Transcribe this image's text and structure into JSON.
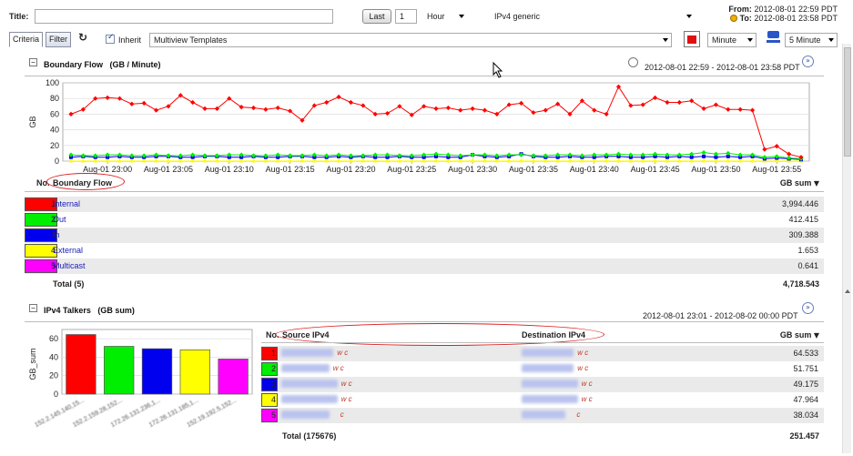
{
  "toolbar": {
    "title_label": "Title:",
    "title_value": "",
    "last_button": "Last",
    "last_count": "1",
    "unit": "Hour",
    "template": "IPv4 generic",
    "from_label": "From:",
    "from_value": "2012-08-01 22:59 PDT",
    "to_label": "To:",
    "to_value": "2012-08-01 23:58 PDT"
  },
  "tabs": [
    {
      "label": "Criteria"
    },
    {
      "label": "Filter"
    }
  ],
  "inherit_label": "Inherit",
  "multiview": "Multiview Templates",
  "granularity": "Minute",
  "interval": "5 Minute",
  "boundary": {
    "title": "Boundary Flow",
    "unit": "(GB / Minute)",
    "range": "2012-08-01 22:59  - 2012-08-01 23:58 PDT",
    "col_no": "No.",
    "col_name": "Boundary Flow",
    "col_sum": "GB sum",
    "rows": [
      {
        "no": "1",
        "name": "Internal",
        "value": "3,994.446",
        "color": "#ff0000"
      },
      {
        "no": "2",
        "name": "Out",
        "value": "412.415",
        "color": "#00ee00"
      },
      {
        "no": "3",
        "name": "In",
        "value": "309.388",
        "color": "#0000ee"
      },
      {
        "no": "4",
        "name": "External",
        "value": "1.653",
        "color": "#ffff00"
      },
      {
        "no": "5",
        "name": "Multicast",
        "value": "0.641",
        "color": "#ff00ff"
      }
    ],
    "total_label": "Total (5)",
    "total_value": "4,718.543"
  },
  "talkers": {
    "title": "IPv4 Talkers",
    "unit": "(GB sum)",
    "range": "2012-08-01 23:01  - 2012-08-02 00:00 PDT",
    "col_no": "No.",
    "col_src": "Source IPv4",
    "col_dst": "Destination IPv4",
    "col_sum": "GB sum",
    "rows": [
      {
        "no": "1",
        "src": "152.2.145.140",
        "dst": "152.19.133.19",
        "value": "64.533",
        "color": "#ff0000"
      },
      {
        "no": "2",
        "src": "152.2.159.28",
        "dst": "152.19.133.17",
        "value": "51.751",
        "color": "#00ee00"
      },
      {
        "no": "3",
        "src": "172.26.131.236",
        "dst": "172.27.167.254",
        "value": "49.175",
        "color": "#0000ee"
      },
      {
        "no": "4",
        "src": "172.26.131.185",
        "dst": "172.27.167.253",
        "value": "47.964",
        "color": "#ffff00"
      },
      {
        "no": "5",
        "src": "152.19.192.5",
        "dst": "152.2.3.199",
        "value": "38.034",
        "color": "#ff00ff"
      }
    ],
    "w_tag": "w",
    "c_tag": "c",
    "total_label": "Total (175676)",
    "total_value": "251.457"
  },
  "chart_data": [
    {
      "type": "line",
      "ylabel": "GB",
      "ylim": [
        0,
        100
      ],
      "yticks": [
        0,
        20,
        40,
        60,
        80,
        100
      ],
      "grid": true,
      "x_tick_labels": [
        "Aug-01 23:00",
        "Aug-01 23:05",
        "Aug-01 23:10",
        "Aug-01 23:15",
        "Aug-01 23:20",
        "Aug-01 23:25",
        "Aug-01 23:30",
        "Aug-01 23:35",
        "Aug-01 23:40",
        "Aug-01 23:45",
        "Aug-01 23:50",
        "Aug-01 23:55"
      ],
      "series": [
        {
          "name": "Internal",
          "color": "#ff0000",
          "values": [
            60,
            66,
            80,
            81,
            80,
            73,
            74,
            65,
            70,
            84,
            75,
            67,
            67,
            80,
            69,
            68,
            66,
            68,
            64,
            52,
            71,
            75,
            82,
            75,
            71,
            60,
            61,
            70,
            59,
            70,
            67,
            68,
            65,
            67,
            65,
            60,
            72,
            74,
            62,
            65,
            73,
            60,
            77,
            65,
            60,
            95,
            71,
            72,
            81,
            75,
            75,
            77,
            67,
            72,
            66,
            66,
            65,
            15,
            19,
            9,
            5
          ]
        },
        {
          "name": "Out",
          "color": "#00ee00",
          "values": [
            8,
            7,
            7,
            8,
            8,
            7,
            7,
            8,
            7,
            7,
            8,
            7,
            7,
            8,
            8,
            7,
            7,
            8,
            7,
            7,
            8,
            7,
            8,
            7,
            7,
            8,
            8,
            7,
            7,
            8,
            9,
            8,
            7,
            8,
            8,
            7,
            8,
            8,
            7,
            7,
            8,
            8,
            7,
            8,
            8,
            9,
            8,
            8,
            9,
            8,
            8,
            9,
            11,
            9,
            10,
            8,
            8,
            5,
            6,
            4,
            3
          ]
        },
        {
          "name": "In",
          "color": "#0000ee",
          "values": [
            5,
            6,
            5,
            5,
            6,
            5,
            5,
            6,
            6,
            5,
            5,
            6,
            6,
            5,
            5,
            6,
            5,
            5,
            6,
            6,
            5,
            5,
            6,
            5,
            6,
            5,
            5,
            6,
            5,
            5,
            6,
            5,
            5,
            8,
            6,
            5,
            6,
            9,
            6,
            5,
            5,
            6,
            5,
            5,
            6,
            6,
            5,
            5,
            6,
            5,
            6,
            5,
            6,
            5,
            6,
            5,
            6,
            3,
            4,
            3,
            2
          ]
        },
        {
          "name": "External",
          "color": "#ffff00",
          "values": [
            0.1,
            0.1,
            0.1,
            0.1,
            0.1,
            0.1,
            0.1,
            0.1,
            0.1,
            0.1,
            0.1,
            0.1,
            0.1,
            0.1,
            0.1,
            0.1,
            0.1,
            0.1,
            0.1,
            0.1,
            0.1,
            0.1,
            0.1,
            0.1,
            0.1,
            0.1,
            0.1,
            0.1,
            0.1,
            0.1,
            0.1,
            0.1,
            0.1,
            0.1,
            0.1,
            0.1,
            0.1,
            0.1,
            0.1,
            0.1,
            0.1,
            0.1,
            0.1,
            0.1,
            0.1,
            0.1,
            0.1,
            0.1,
            0.1,
            0.1,
            0.1,
            0.1,
            0.1,
            0.1,
            0.1,
            0.1,
            0.1,
            0.1,
            0.1,
            0.1,
            0.1
          ]
        },
        {
          "name": "Multicast",
          "color": "#ff00ff",
          "values": [
            0,
            0,
            0,
            0,
            0,
            0,
            0,
            0,
            0,
            0,
            0,
            0,
            0,
            0,
            0,
            0,
            0,
            0,
            0,
            0,
            0,
            0,
            0,
            0,
            0,
            0,
            0,
            0,
            0,
            0,
            0,
            0,
            0,
            0,
            0,
            0,
            0,
            0,
            0,
            0,
            0,
            0,
            0,
            0,
            0,
            0,
            0,
            0,
            0,
            0,
            0,
            0,
            0,
            0,
            0,
            0,
            0,
            0,
            0,
            0,
            0
          ]
        }
      ]
    },
    {
      "type": "bar",
      "ylabel": "GB_sum",
      "ylim": [
        0,
        70
      ],
      "yticks": [
        0,
        20,
        40,
        60
      ],
      "grid": true,
      "categories": [
        "152.2.145.140,15...",
        "152.2.159.28,152...",
        "172.26.131.236,1...",
        "172.26.131.185,1...",
        "152.19.192.5,152..."
      ],
      "values": [
        64.533,
        51.751,
        49.175,
        47.964,
        38.034
      ],
      "colors": [
        "#ff0000",
        "#00ee00",
        "#0000ee",
        "#ffff00",
        "#ff00ff"
      ]
    }
  ]
}
